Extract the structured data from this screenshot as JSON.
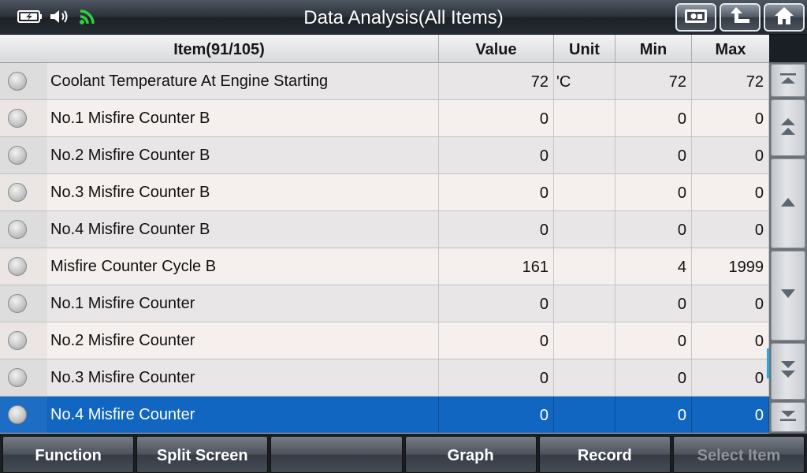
{
  "header": {
    "title": "Data Analysis(All Items)",
    "status_icons": [
      "battery-icon",
      "speaker-icon",
      "wifi-icon"
    ],
    "nav_buttons": [
      "screenshot-icon",
      "back-arrow-icon",
      "home-icon"
    ]
  },
  "table": {
    "columns": {
      "item": "Item(91/105)",
      "value": "Value",
      "unit": "Unit",
      "min": "Min",
      "max": "Max"
    },
    "rows": [
      {
        "name": "Coolant Temperature At Engine Starting",
        "value": "72",
        "unit": "'C",
        "min": "72",
        "max": "72"
      },
      {
        "name": "No.1 Misfire Counter B",
        "value": "0",
        "unit": "",
        "min": "0",
        "max": "0"
      },
      {
        "name": "No.2 Misfire Counter B",
        "value": "0",
        "unit": "",
        "min": "0",
        "max": "0"
      },
      {
        "name": "No.3 Misfire Counter B",
        "value": "0",
        "unit": "",
        "min": "0",
        "max": "0"
      },
      {
        "name": "No.4 Misfire Counter B",
        "value": "0",
        "unit": "",
        "min": "0",
        "max": "0"
      },
      {
        "name": "Misfire Counter Cycle B",
        "value": "161",
        "unit": "",
        "min": "4",
        "max": "1999"
      },
      {
        "name": "No.1 Misfire Counter",
        "value": "0",
        "unit": "",
        "min": "0",
        "max": "0"
      },
      {
        "name": "No.2 Misfire Counter",
        "value": "0",
        "unit": "",
        "min": "0",
        "max": "0"
      },
      {
        "name": "No.3 Misfire Counter",
        "value": "0",
        "unit": "",
        "min": "0",
        "max": "0"
      },
      {
        "name": "No.4 Misfire Counter",
        "value": "0",
        "unit": "",
        "min": "0",
        "max": "0"
      }
    ],
    "selected_index": 9
  },
  "scroll_buttons": [
    "scroll-top-icon",
    "page-up-icon",
    "line-up-icon",
    "line-down-icon",
    "page-down-icon",
    "scroll-bottom-icon"
  ],
  "toolbar": {
    "function": "Function",
    "split_screen": "Split Screen",
    "blank": "",
    "graph": "Graph",
    "record": "Record",
    "select_item": "Select Item"
  },
  "colors": {
    "selected_row": "#1166c2",
    "wifi": "#2fd13f",
    "scroll_indicator": "#2aa6f0"
  }
}
